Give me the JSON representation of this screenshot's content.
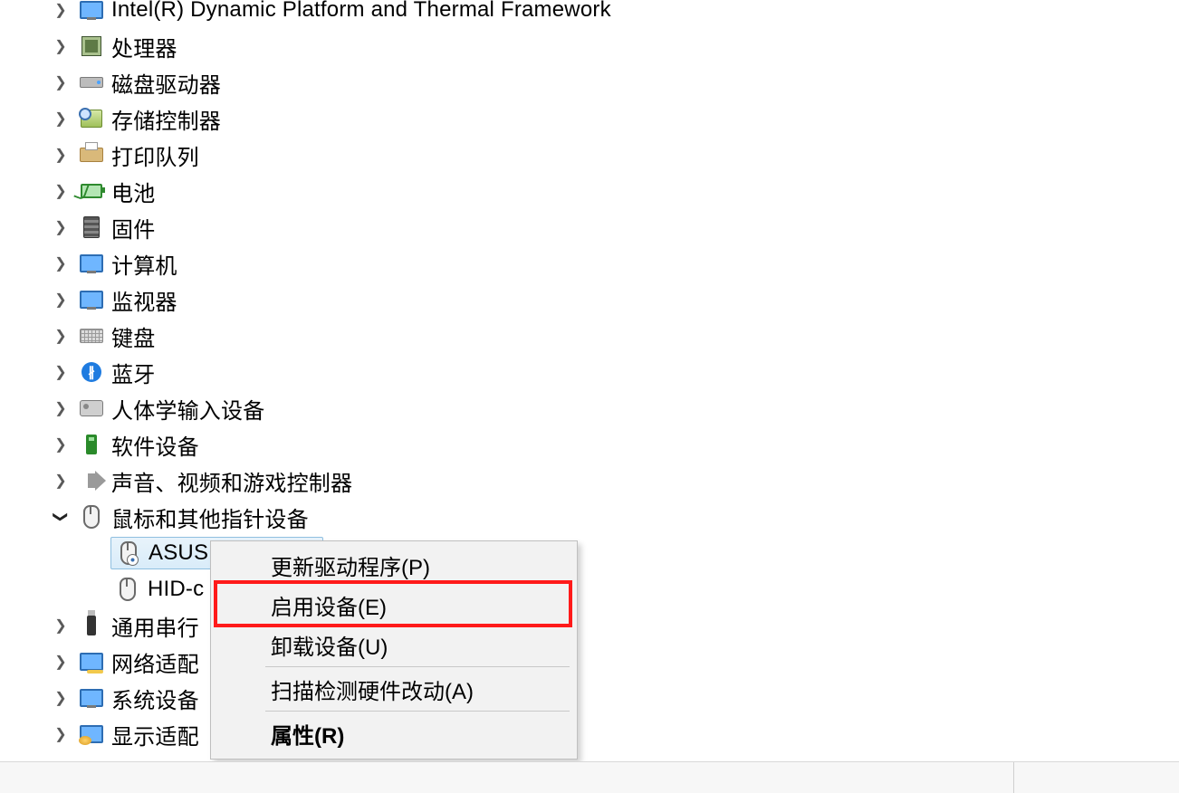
{
  "tree": {
    "categories": [
      {
        "icon": "monitor",
        "label": "Intel(R) Dynamic Platform and Thermal Framework",
        "expanded": false
      },
      {
        "icon": "cpu",
        "label": "处理器",
        "expanded": false
      },
      {
        "icon": "disk",
        "label": "磁盘驱动器",
        "expanded": false
      },
      {
        "icon": "storage",
        "label": "存储控制器",
        "expanded": false
      },
      {
        "icon": "printer",
        "label": "打印队列",
        "expanded": false
      },
      {
        "icon": "battery",
        "label": "电池",
        "expanded": false
      },
      {
        "icon": "firmware",
        "label": "固件",
        "expanded": false
      },
      {
        "icon": "monitor",
        "label": "计算机",
        "expanded": false
      },
      {
        "icon": "monitor",
        "label": "监视器",
        "expanded": false
      },
      {
        "icon": "keyboard",
        "label": "键盘",
        "expanded": false
      },
      {
        "icon": "bt",
        "label": "蓝牙",
        "expanded": false
      },
      {
        "icon": "hid",
        "label": "人体学输入设备",
        "expanded": false
      },
      {
        "icon": "soft",
        "label": "软件设备",
        "expanded": false
      },
      {
        "icon": "speaker",
        "label": "声音、视频和游戏控制器",
        "expanded": false
      },
      {
        "icon": "mouse",
        "label": "鼠标和其他指针设备",
        "expanded": true,
        "children": [
          {
            "icon": "mouse-badge",
            "label": "ASUS",
            "selected": true,
            "truncated": true
          },
          {
            "icon": "mouse",
            "label": "HID-c",
            "selected": false,
            "truncated": true
          }
        ]
      },
      {
        "icon": "usb",
        "label": "通用串行",
        "expanded": false,
        "truncated": true
      },
      {
        "icon": "net",
        "label": "网络适配",
        "expanded": false,
        "truncated": true
      },
      {
        "icon": "monitor",
        "label": "系统设备",
        "expanded": false,
        "truncated": true
      },
      {
        "icon": "display",
        "label": "显示适配",
        "expanded": false,
        "truncated": true
      }
    ]
  },
  "context_menu": {
    "items": [
      {
        "label": "更新驱动程序(P)",
        "highlighted": false
      },
      {
        "label": "启用设备(E)",
        "highlighted": true
      },
      {
        "label": "卸载设备(U)",
        "highlighted": false
      },
      {
        "separator": true
      },
      {
        "label": "扫描检测硬件改动(A)",
        "highlighted": false
      },
      {
        "separator": true
      },
      {
        "label": "属性(R)",
        "highlighted": false,
        "bold": true
      }
    ],
    "highlight_color": "#ff1a1a"
  }
}
